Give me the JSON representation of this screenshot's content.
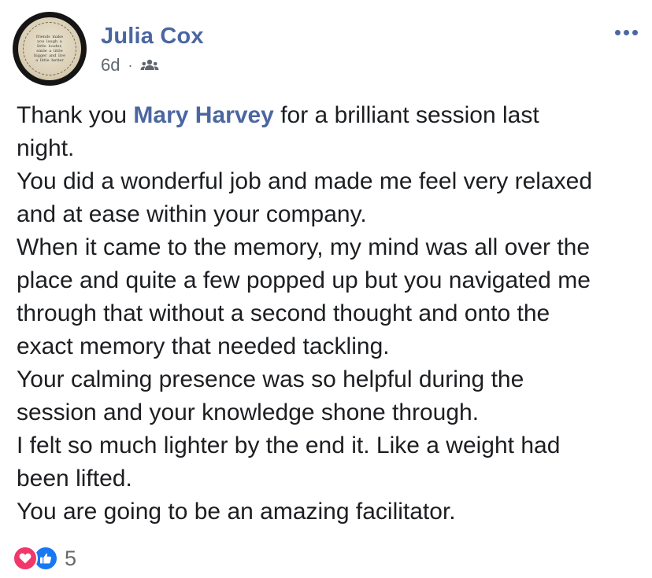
{
  "post": {
    "author": "Julia Cox",
    "time": "6d",
    "separator": "·",
    "audience_icon": "friends-icon",
    "avatar_text": "friends make you laugh a little louder, smile a little bigger and live a little better",
    "body": {
      "line1_before": "Thank you ",
      "mention": "Mary Harvey",
      "line1_after": " for a brilliant session last",
      "lines": [
        "night.",
        "You did a wonderful job and made me feel very relaxed",
        "and at ease within your company.",
        "When it came to the memory, my mind was all over the",
        "place and quite a few popped up but you navigated me",
        "through that without a second thought and onto the",
        "exact memory that needed tackling.",
        "Your calming presence was so helpful during the",
        "session and your knowledge shone through.",
        "I felt so much lighter by the end it. Like a weight had",
        "been lifted.",
        "You are going to be an amazing facilitator."
      ]
    },
    "reactions": {
      "icons": [
        "love-icon",
        "like-icon"
      ],
      "count": "5"
    }
  },
  "colors": {
    "author": "#4b67a1",
    "text": "#1c1e21",
    "meta": "#606770",
    "love": "#f0386b",
    "like": "#1877f2"
  }
}
